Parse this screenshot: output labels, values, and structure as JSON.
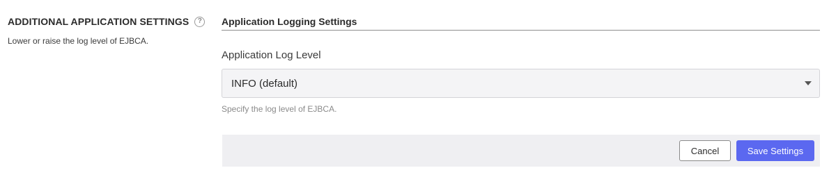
{
  "section": {
    "title": "ADDITIONAL APPLICATION SETTINGS",
    "help_icon": "question-circle-icon",
    "description": "Lower or raise the log level of EJBCA."
  },
  "panel": {
    "title": "Application Logging Settings",
    "field": {
      "label": "Application Log Level",
      "selected_value": "INFO (default)",
      "help": "Specify the log level of EJBCA."
    }
  },
  "actions": {
    "cancel_label": "Cancel",
    "save_label": "Save Settings"
  },
  "colors": {
    "primary": "#5b68f0",
    "action_bar_bg": "#efeff2",
    "select_bg": "#f4f4f6"
  }
}
